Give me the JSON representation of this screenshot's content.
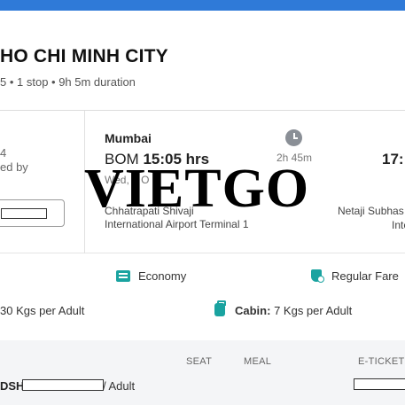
{
  "header": {
    "accent_color": "#2f7ad8"
  },
  "trip": {
    "title": "HO CHI MINH CITY",
    "subtitle": "5 • 1 stop • 9h 5m duration"
  },
  "left_fragment": {
    "line1": "4",
    "line2": "ed by"
  },
  "departure": {
    "city": "Mumbai",
    "code": "BOM",
    "time": "15:05 hrs",
    "date": "Wed, 8 O",
    "airport_line1": "Chhatrapati Shivaji",
    "airport_line2": "International Airport Terminal 1"
  },
  "duration": {
    "icon": "clock-icon",
    "value": "2h 45m"
  },
  "arrival": {
    "time": "17:",
    "airport_line1": "Netaji Subhas",
    "airport_line2": "Inte"
  },
  "watermark": "VIETGO",
  "fare": {
    "cabin_class": "Economy",
    "fare_type": "Regular Fare",
    "icon_color": "#1aa3a0"
  },
  "baggage": {
    "checkin": "30 Kgs per Adult",
    "cabin_label": "Cabin:",
    "cabin_value": "7 Kgs per Adult"
  },
  "passengers": {
    "headers": {
      "seat": "SEAT",
      "meal": "MEAL",
      "eticket": "E-TICKET"
    },
    "rows": [
      {
        "name": "DSH",
        "type": "/ Adult"
      }
    ]
  }
}
